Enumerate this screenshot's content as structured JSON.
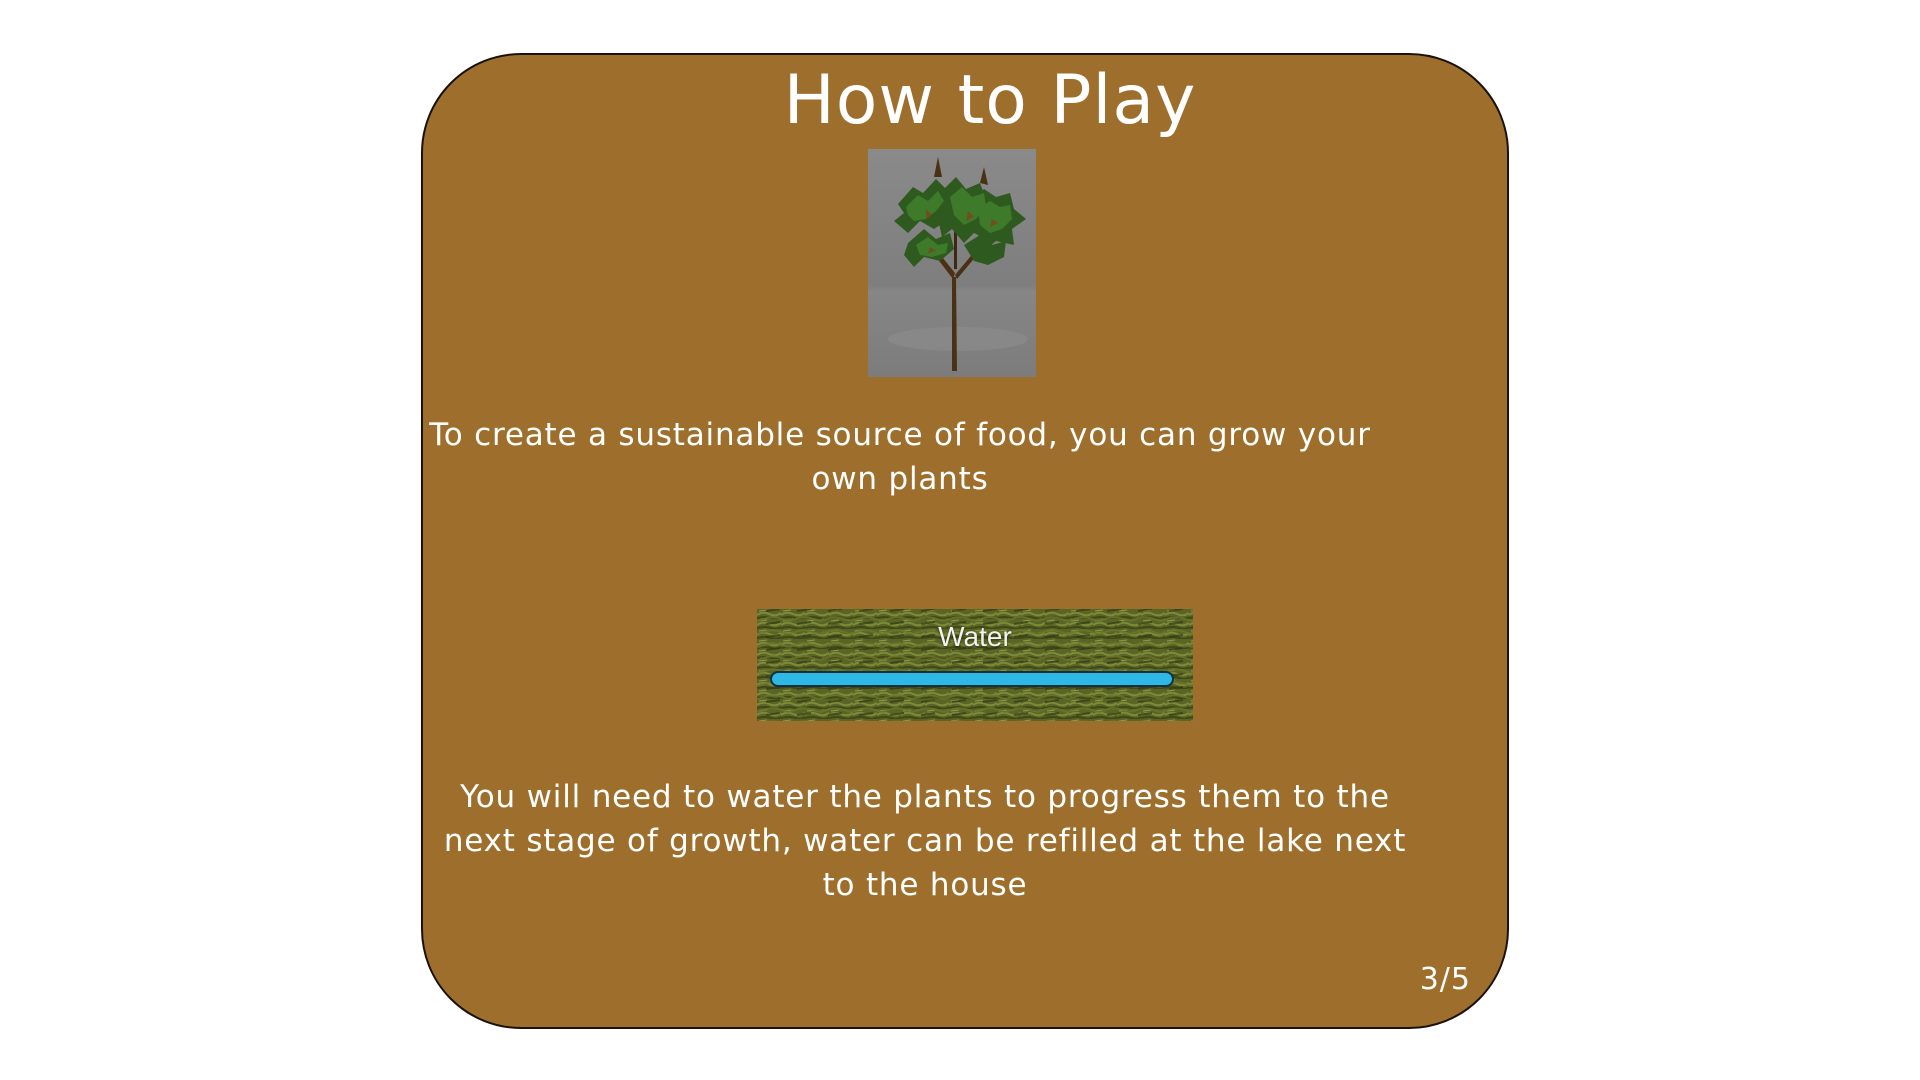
{
  "screen": {
    "title": "How to Play",
    "page_counter": "3/5",
    "panel_color": "#9e6f2c"
  },
  "plant_preview": {
    "icon": "tree-icon"
  },
  "paragraphs": {
    "intro": "To create a sustainable source of food, you can grow your own plants",
    "watering": "You will need to water the plants to progress them to the next stage of growth, water can be refilled at the lake next to the house"
  },
  "water_meter": {
    "label": "Water",
    "level_percent": 100,
    "fill_color": "#2fb8e6"
  }
}
